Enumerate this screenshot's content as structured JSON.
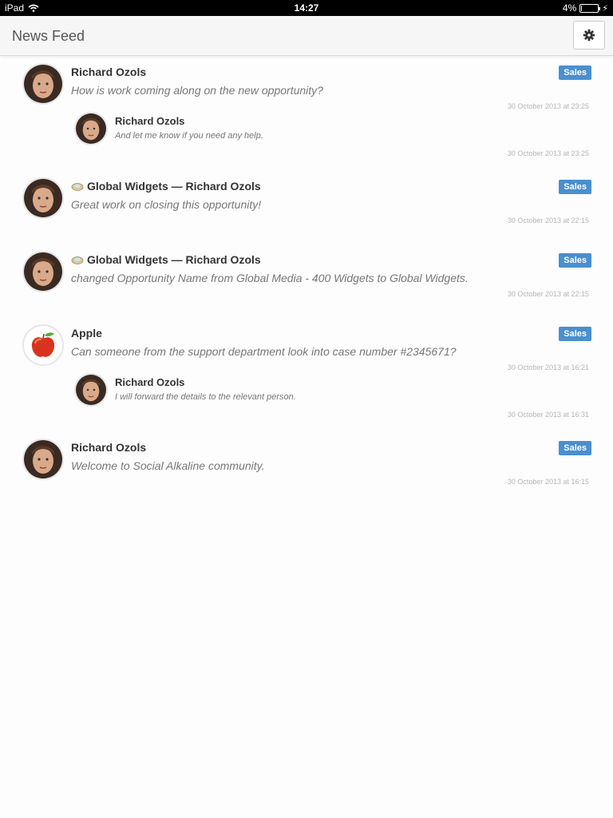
{
  "status_bar": {
    "device": "iPad",
    "time": "14:27",
    "battery": "4%",
    "battery_level": 0.04
  },
  "navbar": {
    "title": "News Feed",
    "settings_icon": "gear-icon"
  },
  "posts": [
    {
      "author": "Richard Ozols",
      "badge": "Sales",
      "message": "How is work coming along on the new opportunity?",
      "timestamp": "30 October 2013 at 23:25",
      "reply": {
        "author": "Richard Ozols",
        "message": "And let me know if you need any help.",
        "timestamp": "30 October 2013 at 23:25"
      }
    },
    {
      "author": "Global Widgets — Richard Ozols",
      "group_icon": "opportunity-icon",
      "badge": "Sales",
      "message": "Great work on closing this opportunity!",
      "timestamp": "30 October 2013 at 22:15"
    },
    {
      "author": "Global Widgets — Richard Ozols",
      "group_icon": "opportunity-icon",
      "badge": "Sales",
      "message": "changed Opportunity Name from Global Media - 400 Widgets to Global Widgets.",
      "timestamp": "30 October 2013 at 22:15"
    },
    {
      "author": "Apple",
      "badge": "Sales",
      "message": "Can someone from the support department look into case number #2345671?",
      "timestamp": "30 October 2013 at 16:21",
      "reply": {
        "author": "Richard Ozols",
        "message": "I will forward the details to the relevant person.",
        "timestamp": "30 October 2013 at 16:31"
      }
    },
    {
      "author": "Richard Ozols",
      "badge": "Sales",
      "message": "Welcome to Social Alkaline community.",
      "timestamp": "30 October 2013 at 16:15"
    }
  ],
  "colors": {
    "badge": "#4a8fcf",
    "navbar": "#f6f6f6",
    "status_bar": "#000000"
  }
}
